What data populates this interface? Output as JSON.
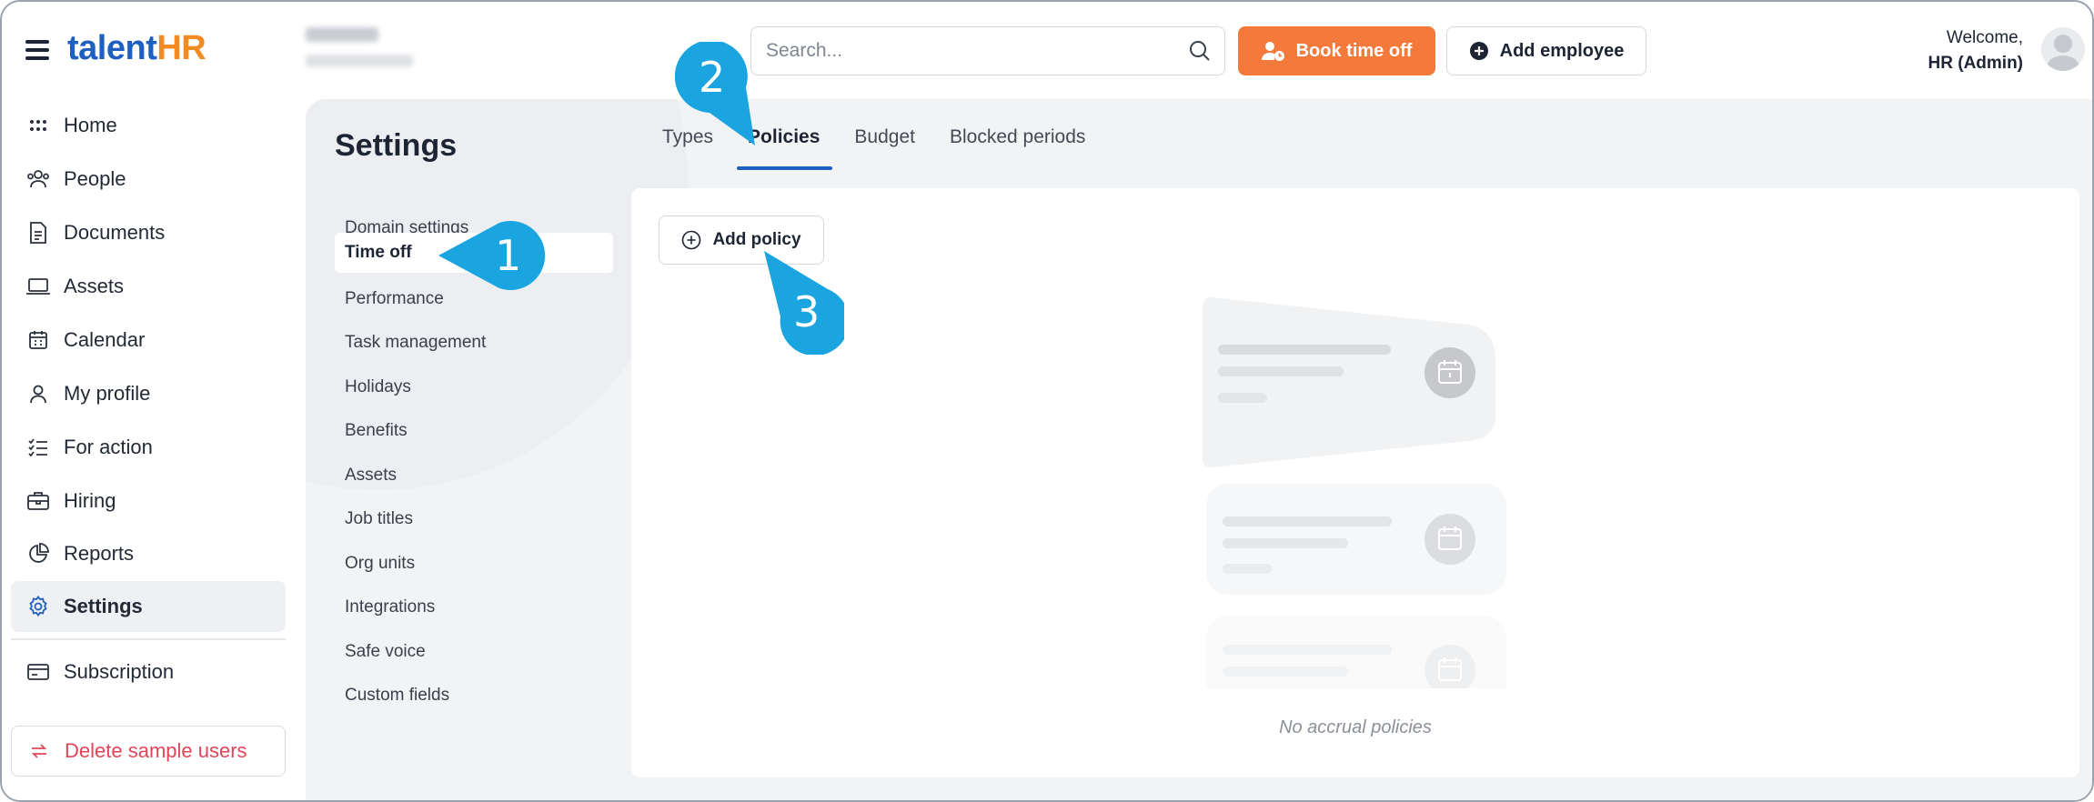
{
  "app": {
    "logo_part1": "talent",
    "logo_part2": "HR"
  },
  "nav": {
    "items": [
      {
        "label": "Home",
        "icon": "grid-icon"
      },
      {
        "label": "People",
        "icon": "people-icon"
      },
      {
        "label": "Documents",
        "icon": "document-icon"
      },
      {
        "label": "Assets",
        "icon": "laptop-icon"
      },
      {
        "label": "Calendar",
        "icon": "calendar-icon"
      },
      {
        "label": "My profile",
        "icon": "user-icon"
      },
      {
        "label": "For action",
        "icon": "checklist-icon"
      },
      {
        "label": "Hiring",
        "icon": "briefcase-icon"
      },
      {
        "label": "Reports",
        "icon": "pie-chart-icon"
      },
      {
        "label": "Settings",
        "icon": "gear-icon",
        "active": true
      },
      {
        "label": "Subscription",
        "icon": "card-icon"
      }
    ],
    "delete_label": "Delete sample users"
  },
  "header": {
    "search_placeholder": "Search...",
    "book_label": "Book time off",
    "add_employee_label": "Add employee",
    "welcome": "Welcome,",
    "user": "HR (Admin)"
  },
  "settings": {
    "title": "Settings",
    "items": [
      "Domain settings",
      "Time off",
      "Performance",
      "Task management",
      "Holidays",
      "Benefits",
      "Assets",
      "Job titles",
      "Org units",
      "Integrations",
      "Safe voice",
      "Custom fields"
    ],
    "active": "Time off"
  },
  "tabs": [
    "Types",
    "Policies",
    "Budget",
    "Blocked periods"
  ],
  "active_tab": "Policies",
  "panel": {
    "add_policy_label": "Add policy",
    "empty_text": "No accrual policies"
  },
  "callouts": [
    "1",
    "2",
    "3"
  ],
  "colors": {
    "brand_blue": "#1f5fbf",
    "brand_orange": "#f28b22",
    "book_button": "#f47a3c",
    "callout": "#1aa4e0",
    "danger": "#e0455a"
  }
}
